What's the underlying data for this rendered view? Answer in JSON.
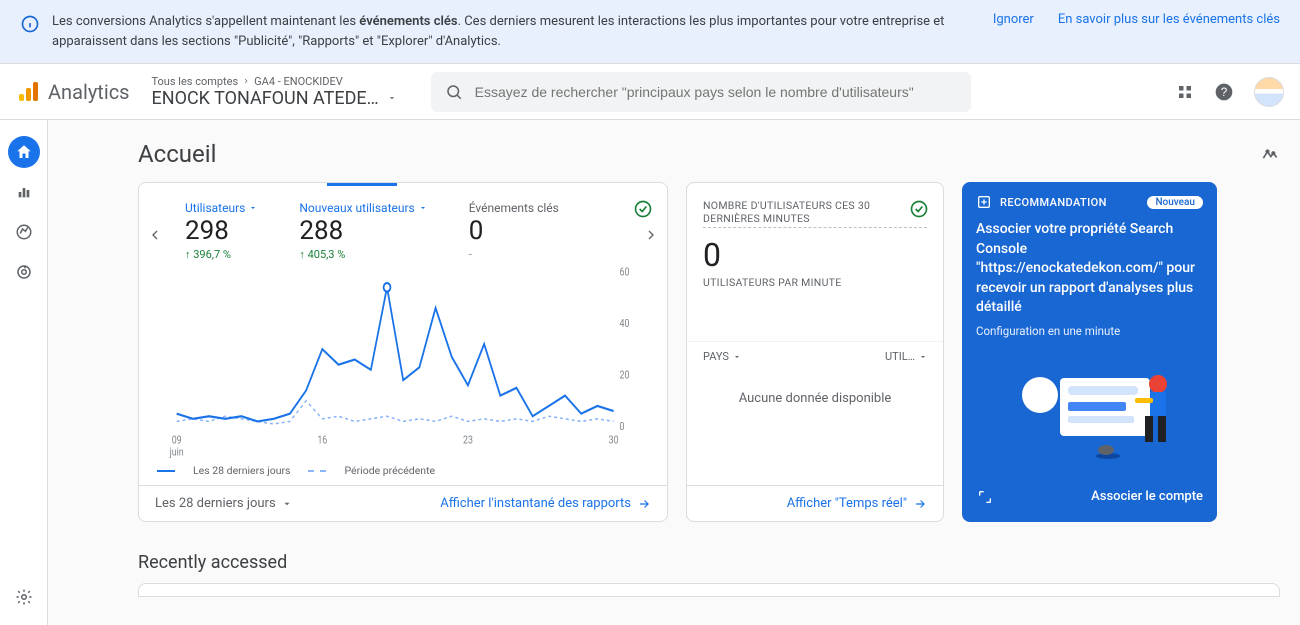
{
  "banner": {
    "msg_pre": "Les conversions Analytics s'appellent maintenant les ",
    "msg_bold": "événements clés",
    "msg_post": ". Ces derniers mesurent les interactions les plus importantes pour votre entreprise et apparaissent dans les sections \"Publicité\", \"Rapports\" et \"Explorer\" d'Analytics.",
    "ignore": "Ignorer",
    "learn": "En savoir plus sur les événements clés"
  },
  "header": {
    "logo_text": "Analytics",
    "breadcrumb_a": "Tous les comptes",
    "breadcrumb_b": "GA4 - ENOCKIDEV",
    "property_title": "ENOCK TONAFOUN ATEDE…",
    "search_placeholder": "Essayez de rechercher \"principaux pays selon le nombre d'utilisateurs\""
  },
  "page": {
    "title": "Accueil",
    "recent": "Recently accessed"
  },
  "chart_card": {
    "metrics": [
      {
        "label": "Utilisateurs",
        "value": "298",
        "delta": "↑ 396,7 %",
        "highlighted": true
      },
      {
        "label": "Nouveaux utilisateurs",
        "value": "288",
        "delta": "↑ 405,3 %",
        "highlighted": true
      },
      {
        "label": "Événements clés",
        "value": "0",
        "delta": "-",
        "highlighted": false
      }
    ],
    "legend_current": "Les 28 derniers jours",
    "legend_prev": "Période précédente",
    "date_selector": "Les 28 derniers jours",
    "action_link": "Afficher l'instantané des rapports"
  },
  "realtime_card": {
    "title": "NOMBRE D'UTILISATEURS CES 30 DERNIÈRES MINUTES",
    "value": "0",
    "subtitle": "UTILISATEURS PAR MINUTE",
    "col1": "PAYS",
    "col2": "UTIL…",
    "nodata": "Aucune donnée disponible",
    "action_link": "Afficher \"Temps réel\""
  },
  "reco_card": {
    "badge": "RECOMMANDATION",
    "new": "Nouveau",
    "headline": "Associer votre propriété Search Console \"https://enockatedekon.com/\" pour recevoir un rapport d'analyses plus détaillé",
    "sub": "Configuration en une minute",
    "link": "Associer le compte"
  },
  "chart_data": {
    "type": "line",
    "ylabel": "",
    "ylim": [
      0,
      60
    ],
    "yticks": [
      0,
      20,
      40,
      60
    ],
    "xticks": [
      "09 juin",
      "16",
      "23",
      "30"
    ],
    "series": [
      {
        "name": "Les 28 derniers jours",
        "values": [
          5,
          3,
          4,
          3,
          4,
          2,
          3,
          5,
          14,
          30,
          24,
          26,
          22,
          54,
          18,
          23,
          46,
          27,
          16,
          32,
          12,
          15,
          4,
          8,
          12,
          5,
          8,
          6
        ]
      },
      {
        "name": "Période précédente",
        "values": [
          2,
          3,
          2,
          4,
          3,
          2,
          1,
          2,
          10,
          3,
          4,
          2,
          3,
          4,
          2,
          3,
          2,
          4,
          2,
          3,
          2,
          3,
          2,
          4,
          3,
          2,
          3,
          2
        ]
      }
    ]
  }
}
